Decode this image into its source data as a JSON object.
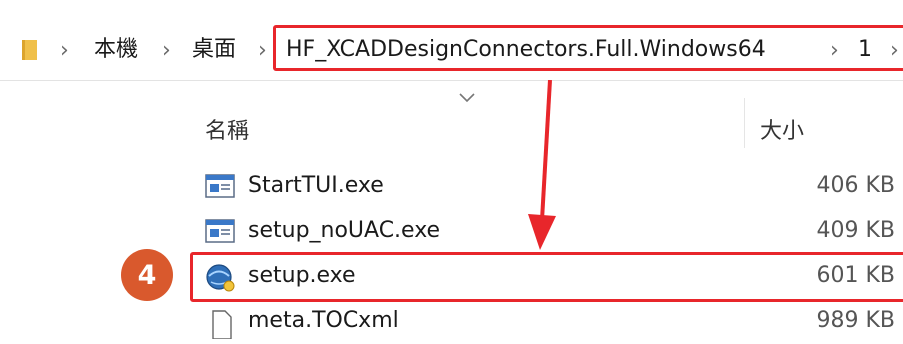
{
  "breadcrumb": {
    "items": [
      "本機",
      "桌面",
      "HF_XCADDesignConnectors.Full.Windows64",
      "1"
    ]
  },
  "columns": {
    "name": "名稱",
    "size": "大小"
  },
  "files": [
    {
      "name": "StartTUI.exe",
      "size": "406 KB",
      "icon": "app-window-icon"
    },
    {
      "name": "setup_noUAC.exe",
      "size": "409 KB",
      "icon": "app-window-icon"
    },
    {
      "name": "setup.exe",
      "size": "601 KB",
      "icon": "setup-globe-icon"
    },
    {
      "name": "meta.TOCxml",
      "size": "989 KB",
      "icon": "document-icon"
    }
  ],
  "annotation": {
    "step": "4"
  },
  "colors": {
    "highlight": "#e8262b",
    "badge": "#d9592d"
  }
}
